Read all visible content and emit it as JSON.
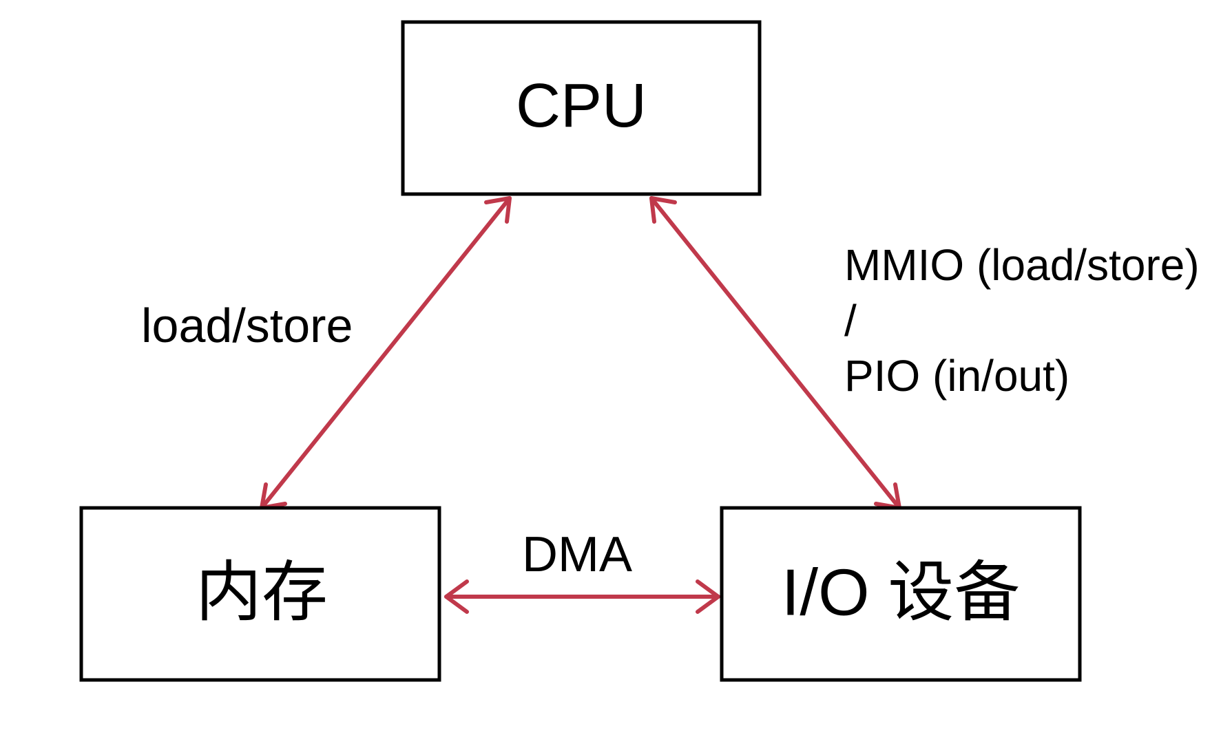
{
  "diagram": {
    "nodes": {
      "cpu": {
        "label": "CPU"
      },
      "memory": {
        "label": "内存"
      },
      "io": {
        "label": "I/O 设备"
      }
    },
    "edges": {
      "cpu_memory": {
        "label": "load/store"
      },
      "cpu_io": {
        "label_line1": "MMIO (load/store)",
        "label_line2": "/",
        "label_line3": "PIO (in/out)"
      },
      "memory_io": {
        "label": "DMA"
      }
    },
    "colors": {
      "arrow": "#C0394B",
      "box_border": "#000000",
      "text": "#000000",
      "background": "#ffffff"
    }
  }
}
